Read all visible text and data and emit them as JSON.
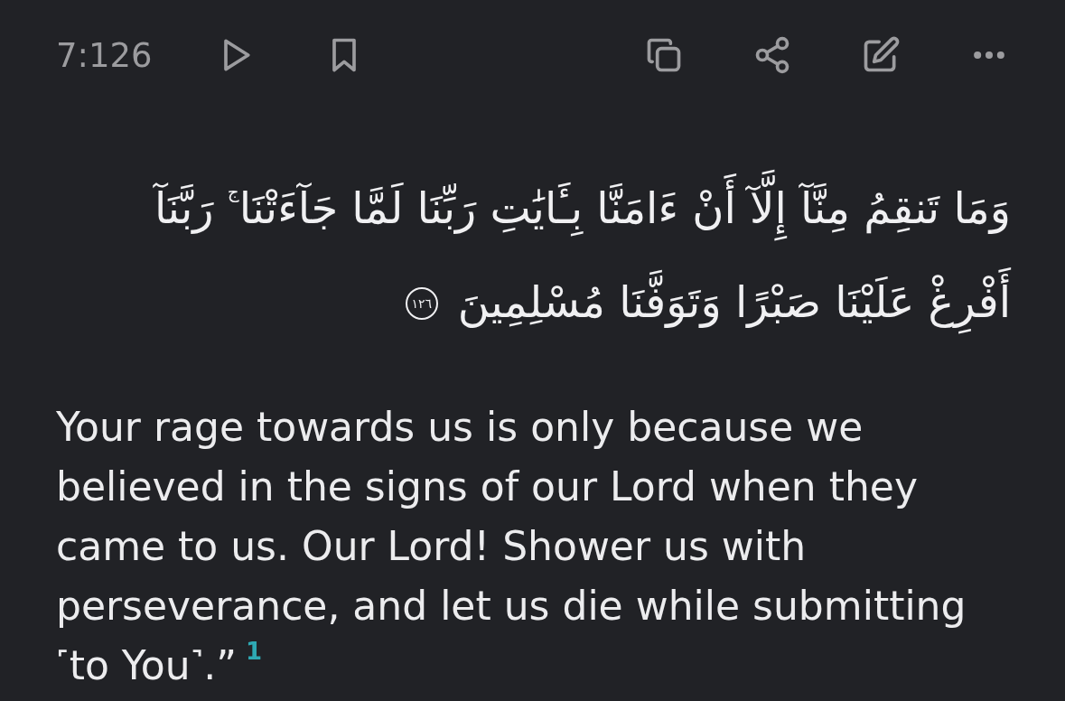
{
  "header": {
    "verse_ref": "7:126",
    "bookmarked": false
  },
  "arabic": {
    "lines": [
      "وَمَا تَنقِمُ مِنَّآ إِلَّآ أَنْ ءَامَنَّا بِـَٔايَٰتِ رَبِّنَا لَمَّا جَآءَتْنَا$^{ج}$ رَبَّنَآ",
      "أَفْرِغْ عَلَيْنَا صَبْرًا وَتَوَفَّنَا مُسْلِمِينَ"
    ],
    "verse_marker": "١٢٦"
  },
  "translation": {
    "text": "Your rage towards us is only because we believed in the signs of our Lord when they came to us. Our Lord! Shower us with perseverance, and let us die while submitting ˹to You˺.”",
    "footnote": "1"
  }
}
